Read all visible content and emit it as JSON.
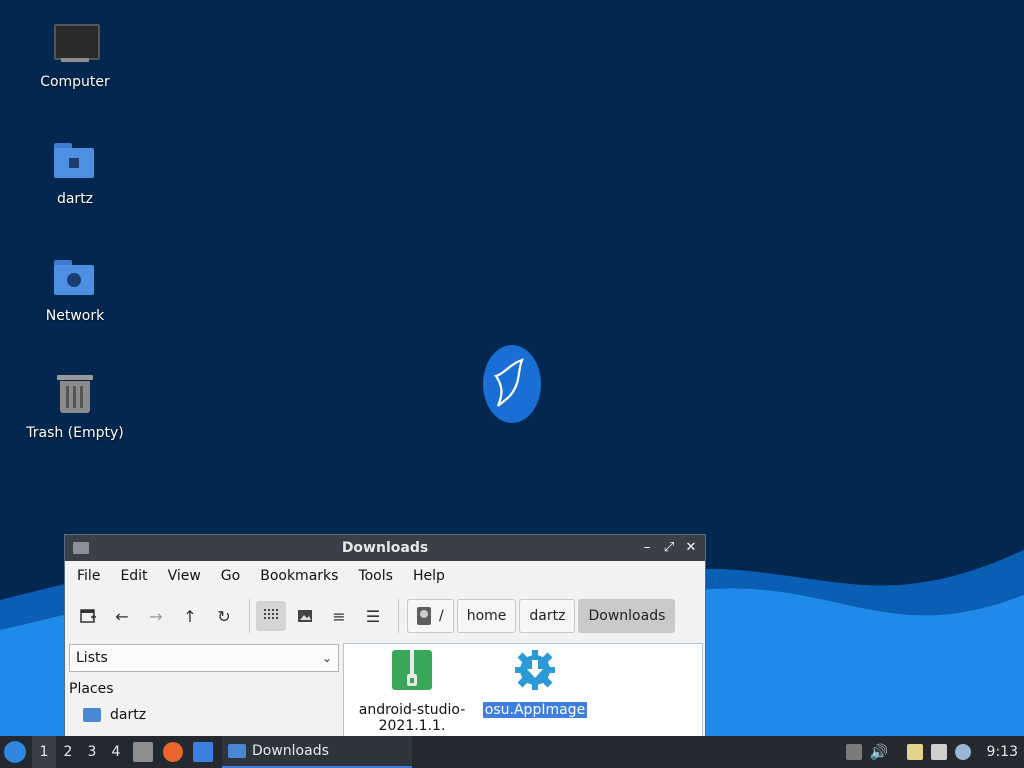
{
  "desktop": {
    "icons": [
      {
        "label": "Computer"
      },
      {
        "label": "dartz"
      },
      {
        "label": "Network"
      },
      {
        "label": "Trash (Empty)"
      }
    ]
  },
  "window": {
    "title": "Downloads",
    "menu": [
      "File",
      "Edit",
      "View",
      "Go",
      "Bookmarks",
      "Tools",
      "Help"
    ],
    "breadcrumb": [
      "/",
      "home",
      "dartz",
      "Downloads"
    ],
    "side_pane_select": "Lists",
    "places_heading": "Places",
    "places": [
      {
        "label": "dartz"
      }
    ],
    "files": [
      {
        "label": "android-studio-2021.1.1.",
        "icon": "archive-icon",
        "selected": false
      },
      {
        "label": "osu.AppImage",
        "icon": "download-gear-icon",
        "selected": true
      }
    ]
  },
  "taskbar": {
    "workspaces": [
      "1",
      "2",
      "3",
      "4"
    ],
    "active_workspace": "1",
    "task_label": "Downloads",
    "clock": "9:13"
  },
  "colors": {
    "desktop_bg": "#03274f",
    "wave": "#1f8ae8",
    "selection": "#3d7ede",
    "taskbar": "#24292f"
  }
}
